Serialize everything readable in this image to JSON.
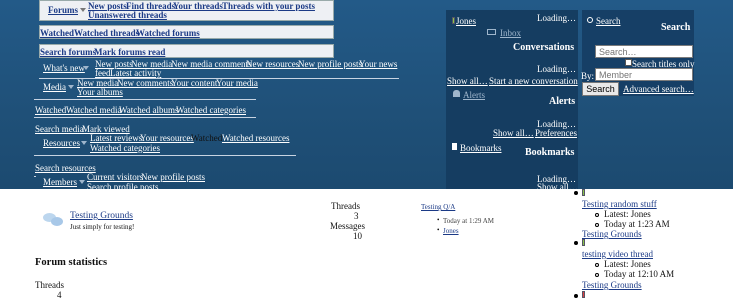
{
  "nav": {
    "forums": {
      "label": "Forums",
      "row1": [
        "New posts",
        "Find threads",
        "Your threads",
        "Threads with your posts"
      ],
      "row2": "Unanswered threads",
      "row3": [
        "Watched",
        "Watched threads",
        "Watched forums"
      ],
      "row4": [
        "Search forums",
        "Mark forums read"
      ]
    },
    "whats_new": {
      "label": "What's new",
      "row1": [
        "New posts",
        "New media",
        "New media comments",
        "New resources",
        "New profile posts",
        "Your news"
      ],
      "row2": [
        "feed",
        "Latest activity"
      ]
    },
    "media": {
      "label": "Media",
      "row1": [
        "New media",
        "New comments",
        "Your content",
        "Your media"
      ],
      "row2": "Your albums",
      "row3": [
        "Watched",
        "Watched media",
        "Watched albums",
        "Watched categories"
      ],
      "row4": [
        "Search media",
        "Mark viewed"
      ]
    },
    "resources": {
      "label": "Resources",
      "row1": [
        "Latest reviews",
        "Your resources"
      ],
      "row1_plain": "Watched",
      "row1_tail": "Watched resources",
      "row2": "Watched categories",
      "row3": "Search resources"
    },
    "members": {
      "label": "Members",
      "row1": [
        "Current visitors",
        "New profile posts"
      ],
      "row2": "Search profile posts"
    }
  },
  "account": {
    "username": "Jones",
    "inbox": "Inbox",
    "loading": "Loading…",
    "conversations_title": "Conversations",
    "show_all": "Show all…",
    "start_conversation": "Start a new conversation",
    "alerts": "Alerts",
    "alerts_title": "Alerts",
    "preferences": "Preferences",
    "bookmarks": "Bookmarks",
    "bookmarks_title": "Bookmarks"
  },
  "search": {
    "link": "Search",
    "title": "Search",
    "placeholder": "Search…",
    "titles_only": "Search titles only",
    "by": "By:",
    "member_placeholder": "Member",
    "button": "Search",
    "advanced": "Advanced search…"
  },
  "forum": {
    "name": "Testing Grounds",
    "description": "Just simply for testing!",
    "threads_label": "Threads",
    "threads_value": "3",
    "messages_label": "Messages",
    "messages_value": "10",
    "latest_title": "Testing Q/A",
    "latest_time": "Today at 1:29 AM",
    "latest_user": "Jones"
  },
  "new_posts": [
    {
      "title": "Testing random stuff",
      "latest": "Latest: Jones",
      "time": "Today at 1:23 AM",
      "forum": "Testing Grounds",
      "avatar_color": "#8bc34a"
    },
    {
      "title": "testing video thread",
      "latest": "Latest: Jones",
      "time": "Today at 12:10 AM",
      "forum": "Testing Grounds",
      "avatar_color": "#8bc34a"
    }
  ],
  "stats": {
    "heading": "Forum statistics",
    "threads_label": "Threads",
    "threads_value": "4"
  },
  "colors": {
    "band": "#1f5078",
    "panel": "#153d61",
    "link": "#1b3a86"
  }
}
